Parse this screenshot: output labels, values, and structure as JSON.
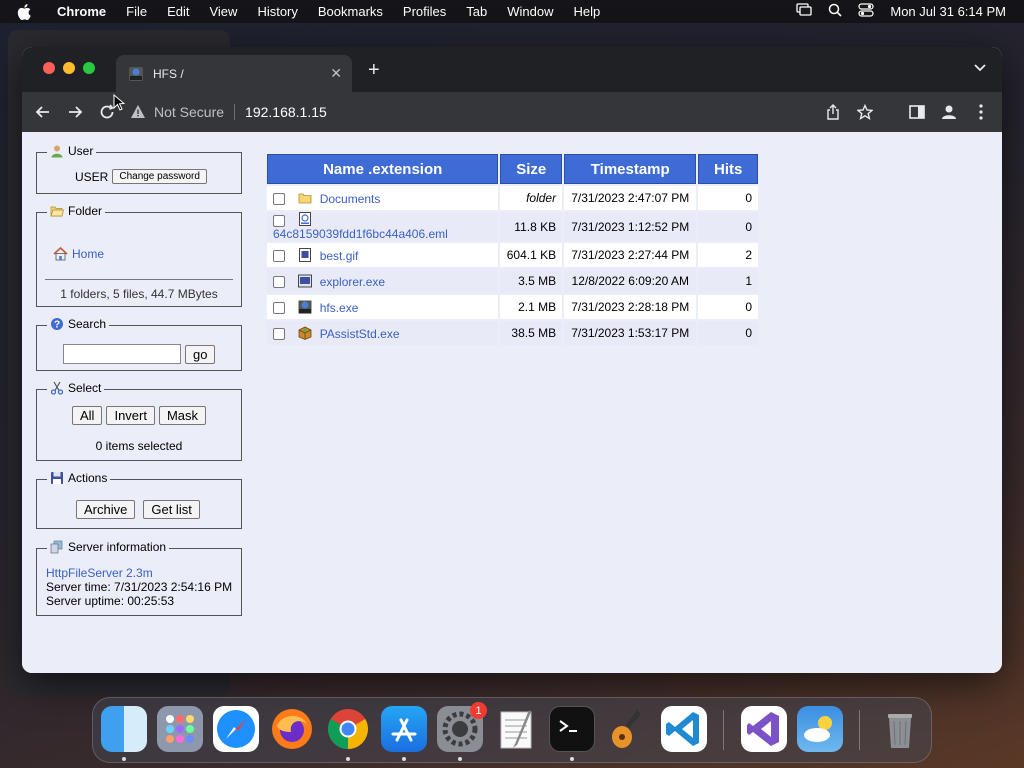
{
  "menubar": {
    "app": "Chrome",
    "items": [
      "File",
      "Edit",
      "View",
      "History",
      "Bookmarks",
      "Profiles",
      "Tab",
      "Window",
      "Help"
    ],
    "clock": "Mon Jul 31  6:14 PM"
  },
  "browser": {
    "tab_title": "HFS /",
    "security_label": "Not Secure",
    "url": "192.168.1.15"
  },
  "sidebar": {
    "user": {
      "legend": "User",
      "username": "USER",
      "change_password_label": "Change password"
    },
    "folder": {
      "legend": "Folder",
      "home_label": "Home",
      "summary": "1 folders, 5 files, 44.7 MBytes"
    },
    "search": {
      "legend": "Search",
      "input_value": "",
      "go_label": "go"
    },
    "select": {
      "legend": "Select",
      "all_label": "All",
      "invert_label": "Invert",
      "mask_label": "Mask",
      "status": "0 items selected"
    },
    "actions": {
      "legend": "Actions",
      "archive_label": "Archive",
      "get_list_label": "Get list"
    },
    "server": {
      "legend": "Server information",
      "version_link": "HttpFileServer 2.3m",
      "server_time": "Server time: 7/31/2023 2:54:16 PM",
      "server_uptime": "Server uptime: 00:25:53"
    }
  },
  "files": {
    "headers": {
      "name": "Name .extension",
      "size": "Size",
      "timestamp": "Timestamp",
      "hits": "Hits"
    },
    "rows": [
      {
        "name": "Documents",
        "size": "folder",
        "timestamp": "7/31/2023 2:47:07 PM",
        "hits": "0",
        "icon": "folder-icon"
      },
      {
        "name": "64c8159039fdd1f6bc44a406.eml",
        "size": "11.8 KB",
        "timestamp": "7/31/2023 1:12:52 PM",
        "hits": "0",
        "icon": "email-file-icon"
      },
      {
        "name": "best.gif",
        "size": "604.1 KB",
        "timestamp": "7/31/2023 2:27:44 PM",
        "hits": "2",
        "icon": "image-file-icon"
      },
      {
        "name": "explorer.exe",
        "size": "3.5 MB",
        "timestamp": "12/8/2022 6:09:20 AM",
        "hits": "1",
        "icon": "exe-file-icon"
      },
      {
        "name": "hfs.exe",
        "size": "2.1 MB",
        "timestamp": "7/31/2023 2:28:18 PM",
        "hits": "0",
        "icon": "hfs-file-icon"
      },
      {
        "name": "PAssistStd.exe",
        "size": "38.5 MB",
        "timestamp": "7/31/2023 1:53:17 PM",
        "hits": "0",
        "icon": "package-file-icon"
      }
    ]
  },
  "dock": {
    "apps": [
      "finder-icon",
      "launchpad-icon",
      "safari-icon",
      "firefox-icon",
      "chrome-icon",
      "app-store-icon",
      "system-settings-icon",
      "textedit-icon",
      "terminal-icon",
      "garageband-icon",
      "vscode-icon",
      "visual-studio-icon",
      "weather-icon",
      "trash-icon"
    ],
    "settings_badge": "1"
  },
  "colors": {
    "header_blue": "#3f6bd6",
    "link_blue": "#3a5fc6",
    "page_bg": "#ebeef8"
  }
}
